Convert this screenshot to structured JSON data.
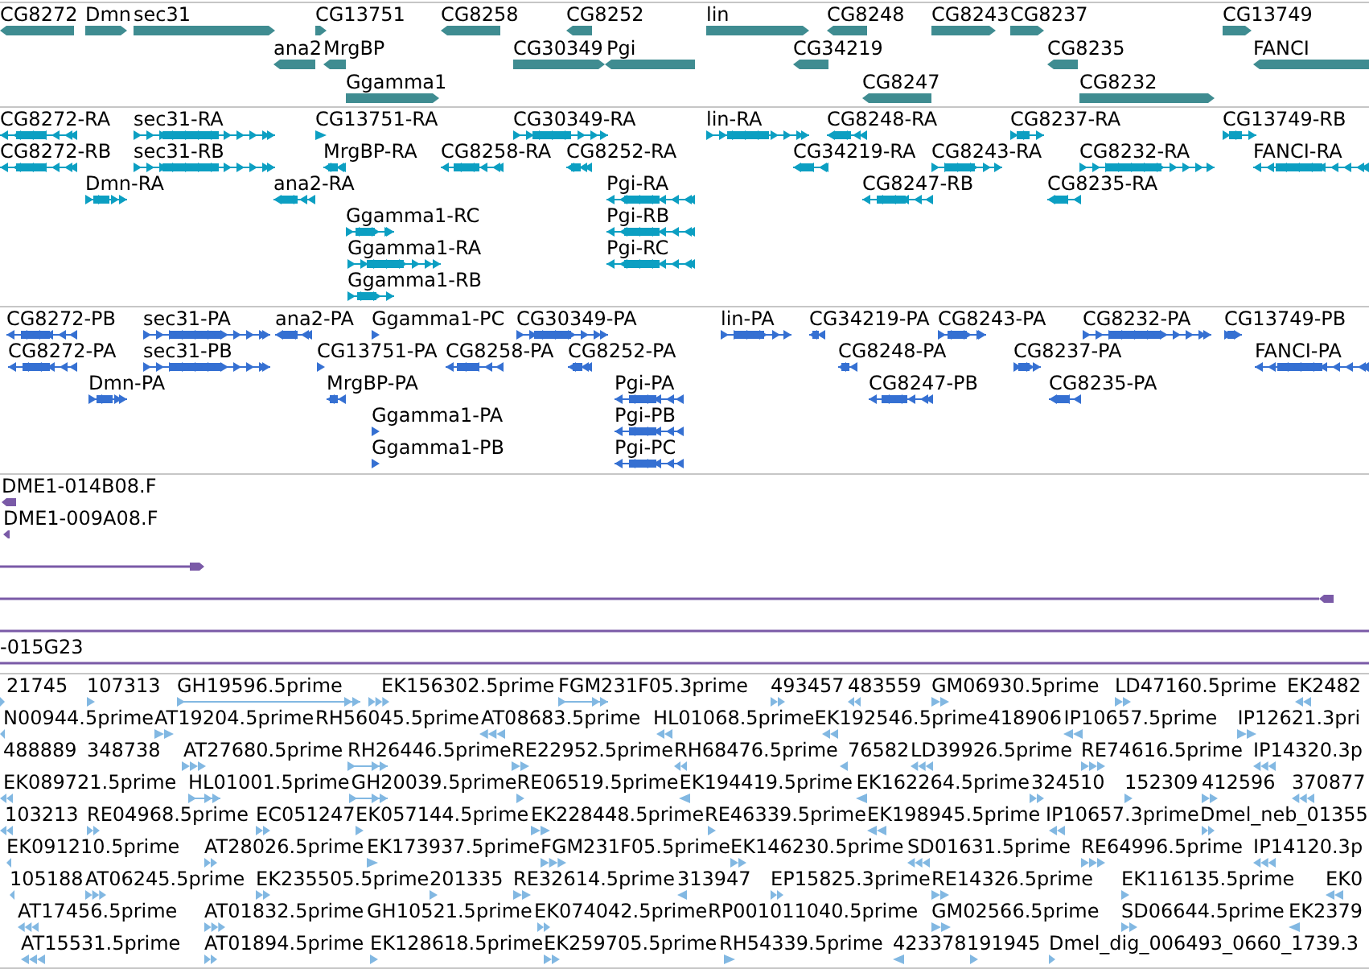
{
  "tracks": [
    {
      "kind": "gene",
      "color": "#3f8c91",
      "features": [
        {
          "label": "CG8272",
          "reverse": true
        },
        {
          "label": "Dmn",
          "reverse": false
        },
        {
          "label": "sec31",
          "reverse": false
        },
        {
          "label": "CG13751",
          "reverse": false
        },
        {
          "label": "CG8258",
          "reverse": true
        },
        {
          "label": "CG8252",
          "reverse": true
        },
        {
          "label": "lin",
          "reverse": false
        },
        {
          "label": "CG8248",
          "reverse": true
        },
        {
          "label": "CG8243",
          "reverse": false
        },
        {
          "label": "CG8237",
          "reverse": false
        },
        {
          "label": "CG13749",
          "reverse": false
        },
        {
          "label": "ana2",
          "reverse": true
        },
        {
          "label": "MrgBP",
          "reverse": true
        },
        {
          "label": "CG30349",
          "reverse": false
        },
        {
          "label": "Pgi",
          "reverse": true
        },
        {
          "label": "CG34219",
          "reverse": true
        },
        {
          "label": "CG8235",
          "reverse": true
        },
        {
          "label": "FANCI",
          "reverse": true
        },
        {
          "label": "Ggamma1",
          "reverse": false
        },
        {
          "label": "CG8247",
          "reverse": true
        },
        {
          "label": "CG8232",
          "reverse": false
        }
      ]
    },
    {
      "kind": "transcript",
      "color": "#0c9fc2",
      "features": [
        {
          "label": "CG8272-RA",
          "reverse": true
        },
        {
          "label": "sec31-RA",
          "reverse": false
        },
        {
          "label": "CG13751-RA",
          "reverse": false
        },
        {
          "label": "CG30349-RA",
          "reverse": false
        },
        {
          "label": "lin-RA",
          "reverse": false
        },
        {
          "label": "CG8248-RA",
          "reverse": true
        },
        {
          "label": "CG8237-RA",
          "reverse": false
        },
        {
          "label": "CG13749-RB",
          "reverse": false
        },
        {
          "label": "CG8272-RB",
          "reverse": true
        },
        {
          "label": "sec31-RB",
          "reverse": false
        },
        {
          "label": "MrgBP-RA",
          "reverse": true
        },
        {
          "label": "CG8258-RA",
          "reverse": true
        },
        {
          "label": "CG8252-RA",
          "reverse": true
        },
        {
          "label": "CG34219-RA",
          "reverse": true
        },
        {
          "label": "CG8243-RA",
          "reverse": false
        },
        {
          "label": "CG8232-RA",
          "reverse": false
        },
        {
          "label": "FANCI-RA",
          "reverse": true
        },
        {
          "label": "Dmn-RA",
          "reverse": false
        },
        {
          "label": "ana2-RA",
          "reverse": true
        },
        {
          "label": "Pgi-RA",
          "reverse": true
        },
        {
          "label": "CG8247-RB",
          "reverse": true
        },
        {
          "label": "CG8235-RA",
          "reverse": true
        },
        {
          "label": "Ggamma1-RC",
          "reverse": false
        },
        {
          "label": "Pgi-RB",
          "reverse": true
        },
        {
          "label": "Ggamma1-RA",
          "reverse": false
        },
        {
          "label": "Pgi-RC",
          "reverse": true
        },
        {
          "label": "Ggamma1-RB",
          "reverse": false
        }
      ]
    },
    {
      "kind": "protein",
      "color": "#3570d2",
      "features": [
        {
          "label": "CG8272-PB",
          "reverse": true
        },
        {
          "label": "sec31-PA",
          "reverse": false
        },
        {
          "label": "ana2-PA",
          "reverse": true
        },
        {
          "label": "Ggamma1-PC",
          "reverse": false
        },
        {
          "label": "CG30349-PA",
          "reverse": false
        },
        {
          "label": "lin-PA",
          "reverse": false
        },
        {
          "label": "CG34219-PA",
          "reverse": true
        },
        {
          "label": "CG8243-PA",
          "reverse": false
        },
        {
          "label": "CG8232-PA",
          "reverse": false
        },
        {
          "label": "CG13749-PB",
          "reverse": false
        },
        {
          "label": "CG8272-PA",
          "reverse": true
        },
        {
          "label": "sec31-PB",
          "reverse": false
        },
        {
          "label": "CG13751-PA",
          "reverse": false
        },
        {
          "label": "CG8258-PA",
          "reverse": true
        },
        {
          "label": "CG8252-PA",
          "reverse": true
        },
        {
          "label": "CG8248-PA",
          "reverse": true
        },
        {
          "label": "CG8237-PA",
          "reverse": false
        },
        {
          "label": "FANCI-PA",
          "reverse": true
        },
        {
          "label": "Dmn-PA",
          "reverse": false
        },
        {
          "label": "MrgBP-PA",
          "reverse": true
        },
        {
          "label": "Pgi-PA",
          "reverse": true
        },
        {
          "label": "CG8247-PB",
          "reverse": true
        },
        {
          "label": "CG8235-PA",
          "reverse": true
        },
        {
          "label": "Ggamma1-PA",
          "reverse": false
        },
        {
          "label": "Pgi-PB",
          "reverse": true
        },
        {
          "label": "Ggamma1-PB",
          "reverse": false
        },
        {
          "label": "Pgi-PC",
          "reverse": true
        }
      ]
    },
    {
      "kind": "est",
      "color": "#7a5aa7",
      "features": [
        {
          "kind": "arrow",
          "label": "DME1-014B08.F",
          "reverse": true
        },
        {
          "kind": "arrow",
          "label": "DME1-009A08.F",
          "reverse": true
        },
        {
          "kind": "arrow",
          "reverse": false
        },
        {
          "kind": "arrow",
          "reverse": true
        },
        {
          "kind": "line"
        },
        {
          "kind": "line",
          "label": "-015G23"
        }
      ]
    },
    {
      "kind": "read",
      "color": "#82b8e2",
      "features": [
        {
          "label": "21745",
          "reverse": false
        },
        {
          "label": "107313",
          "reverse": false
        },
        {
          "label": "GH19596.5prime",
          "reverse": false
        },
        {
          "label": "EK156302.5prime",
          "reverse": false
        },
        {
          "label": "FGM231F05.3prime",
          "reverse": false
        },
        {
          "label": "493457",
          "reverse": false
        },
        {
          "label": "483559",
          "reverse": true
        },
        {
          "label": "GM06930.5prime",
          "reverse": false
        },
        {
          "label": "LD47160.5prime",
          "reverse": false
        },
        {
          "label": "EK2482",
          "reverse": true
        },
        {
          "label": "N00944.5prime",
          "reverse": true
        },
        {
          "label": "AT19204.5prime",
          "reverse": false
        },
        {
          "label": "RH56045.5prime"
        },
        {
          "label": "AT08683.5prime",
          "reverse": true
        },
        {
          "label": "HL01068.5prime",
          "reverse": true
        },
        {
          "label": "EK192546.5prime",
          "reverse": true
        },
        {
          "label": "418906"
        },
        {
          "label": "IP10657.5prime",
          "reverse": true
        },
        {
          "label": "IP12621.3pri",
          "reverse": false
        },
        {
          "label": "488889"
        },
        {
          "label": "348738"
        },
        {
          "label": "AT27680.5prime",
          "reverse": false
        },
        {
          "label": "RH26446.5prime",
          "reverse": false
        },
        {
          "label": "RE22952.5prime",
          "reverse": false
        },
        {
          "label": "RH68476.5prime",
          "reverse": true
        },
        {
          "label": "76582",
          "reverse": true
        },
        {
          "label": "LD39926.5prime",
          "reverse": true
        },
        {
          "label": "RE74616.5prime",
          "reverse": false
        },
        {
          "label": "IP14320.3p",
          "reverse": true
        },
        {
          "label": "EK089721.5prime",
          "reverse": true
        },
        {
          "label": "HL01001.5prime",
          "reverse": false
        },
        {
          "label": "GH20039.5prime",
          "reverse": false
        },
        {
          "label": "RE06519.5prime",
          "reverse": false
        },
        {
          "label": "EK194419.5prime",
          "reverse": true
        },
        {
          "label": "EK162264.5prime",
          "reverse": true
        },
        {
          "label": "324510",
          "reverse": false
        },
        {
          "label": "152309",
          "reverse": false
        },
        {
          "label": "412596",
          "reverse": false
        },
        {
          "label": "370877",
          "reverse": true
        },
        {
          "label": "103213",
          "reverse": true
        },
        {
          "label": "RE04968.5prime",
          "reverse": false
        },
        {
          "label": "EC051247",
          "reverse": false
        },
        {
          "label": "EK057144.5prime",
          "reverse": false
        },
        {
          "label": "EK228448.5prime",
          "reverse": false
        },
        {
          "label": "RE46339.5prime",
          "reverse": false
        },
        {
          "label": "EK198945.5prime",
          "reverse": true
        },
        {
          "label": "IP10657.3prime",
          "reverse": true
        },
        {
          "label": "Dmel_neb_01355",
          "reverse": false
        },
        {
          "label": "EK091210.5prime",
          "reverse": true
        },
        {
          "label": "AT28026.5prime",
          "reverse": false
        },
        {
          "label": "EK173937.5prime",
          "reverse": false
        },
        {
          "label": "FGM231F05.5prime",
          "reverse": false
        },
        {
          "label": "EK146230.5prime",
          "reverse": false
        },
        {
          "label": "SD01631.5prime",
          "reverse": true
        },
        {
          "label": "RE64996.5prime",
          "reverse": false
        },
        {
          "label": "IP14120.3p",
          "reverse": true
        },
        {
          "label": "105188",
          "reverse": true
        },
        {
          "label": "AT06245.5prime",
          "reverse": false
        },
        {
          "label": "EK235505.5prime",
          "reverse": false
        },
        {
          "label": "201335",
          "reverse": false
        },
        {
          "label": "RE32614.5prime",
          "reverse": false
        },
        {
          "label": "313947",
          "reverse": true
        },
        {
          "label": "EP15825.3prime",
          "reverse": false
        },
        {
          "label": "RE14326.5prime",
          "reverse": false
        },
        {
          "label": "EK116135.5prime",
          "reverse": false
        },
        {
          "label": "EK0",
          "reverse": true
        },
        {
          "label": "AT17456.5prime",
          "reverse": true
        },
        {
          "label": "AT01832.5prime",
          "reverse": false
        },
        {
          "label": "GH10521.5prime"
        },
        {
          "label": "EK074042.5prime",
          "reverse": false
        },
        {
          "label": "RP001011040.5prime"
        },
        {
          "label": "GM02566.5prime",
          "reverse": false
        },
        {
          "label": "SD06644.5prime",
          "reverse": false
        },
        {
          "label": "EK2379",
          "reverse": true
        },
        {
          "label": "AT15531.5prime",
          "reverse": true
        },
        {
          "label": "AT01894.5prime",
          "reverse": false
        },
        {
          "label": "EK128618.5prime",
          "reverse": false
        },
        {
          "label": "EK259705.5prime",
          "reverse": false
        },
        {
          "label": "RH54339.5prime",
          "reverse": false
        },
        {
          "label": "423378",
          "reverse": true
        },
        {
          "label": "191945",
          "reverse": false
        },
        {
          "label": "Dmel_dig_006493_0660_1739.3",
          "reverse": false
        }
      ]
    }
  ]
}
